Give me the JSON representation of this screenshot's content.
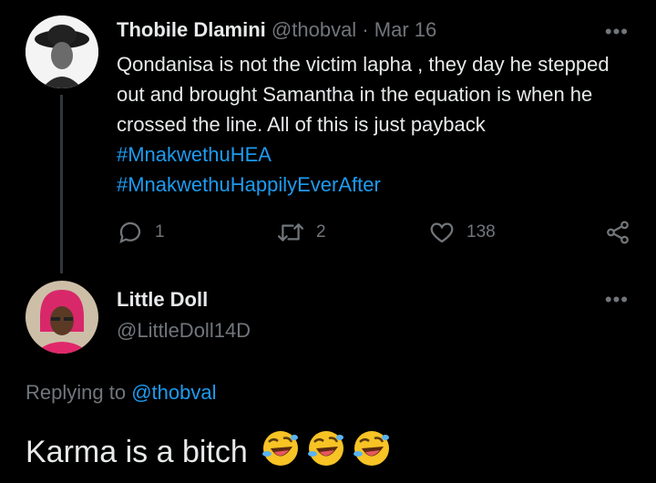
{
  "tweet1": {
    "display_name": "Thobile Dlamini",
    "handle": "@thobval",
    "separator": "·",
    "date": "Mar 16",
    "text_plain": "Qondanisa is not the victim lapha , they day he stepped out and brought Samantha in the equation is when he crossed the line.  All of this is just payback ",
    "hashtag1": "#MnakwethuHEA",
    "hashtag2": "#MnakwethuHappilyEverAfter",
    "more_label": "•••",
    "replies": "1",
    "retweets": "2",
    "likes": "138"
  },
  "tweet2": {
    "display_name": "Little Doll",
    "handle": "@LittleDoll14D",
    "more_label": "•••",
    "replying_prefix": "Replying to ",
    "replying_handle": "@thobval",
    "text": "Karma is a bitch",
    "emoji_name": "rolling-on-the-floor-laughing",
    "emoji_count": 3
  },
  "colors": {
    "background": "#000000",
    "text": "#e7e9ea",
    "muted": "#71767b",
    "link": "#1d9bf0",
    "thread_line": "#333639"
  }
}
